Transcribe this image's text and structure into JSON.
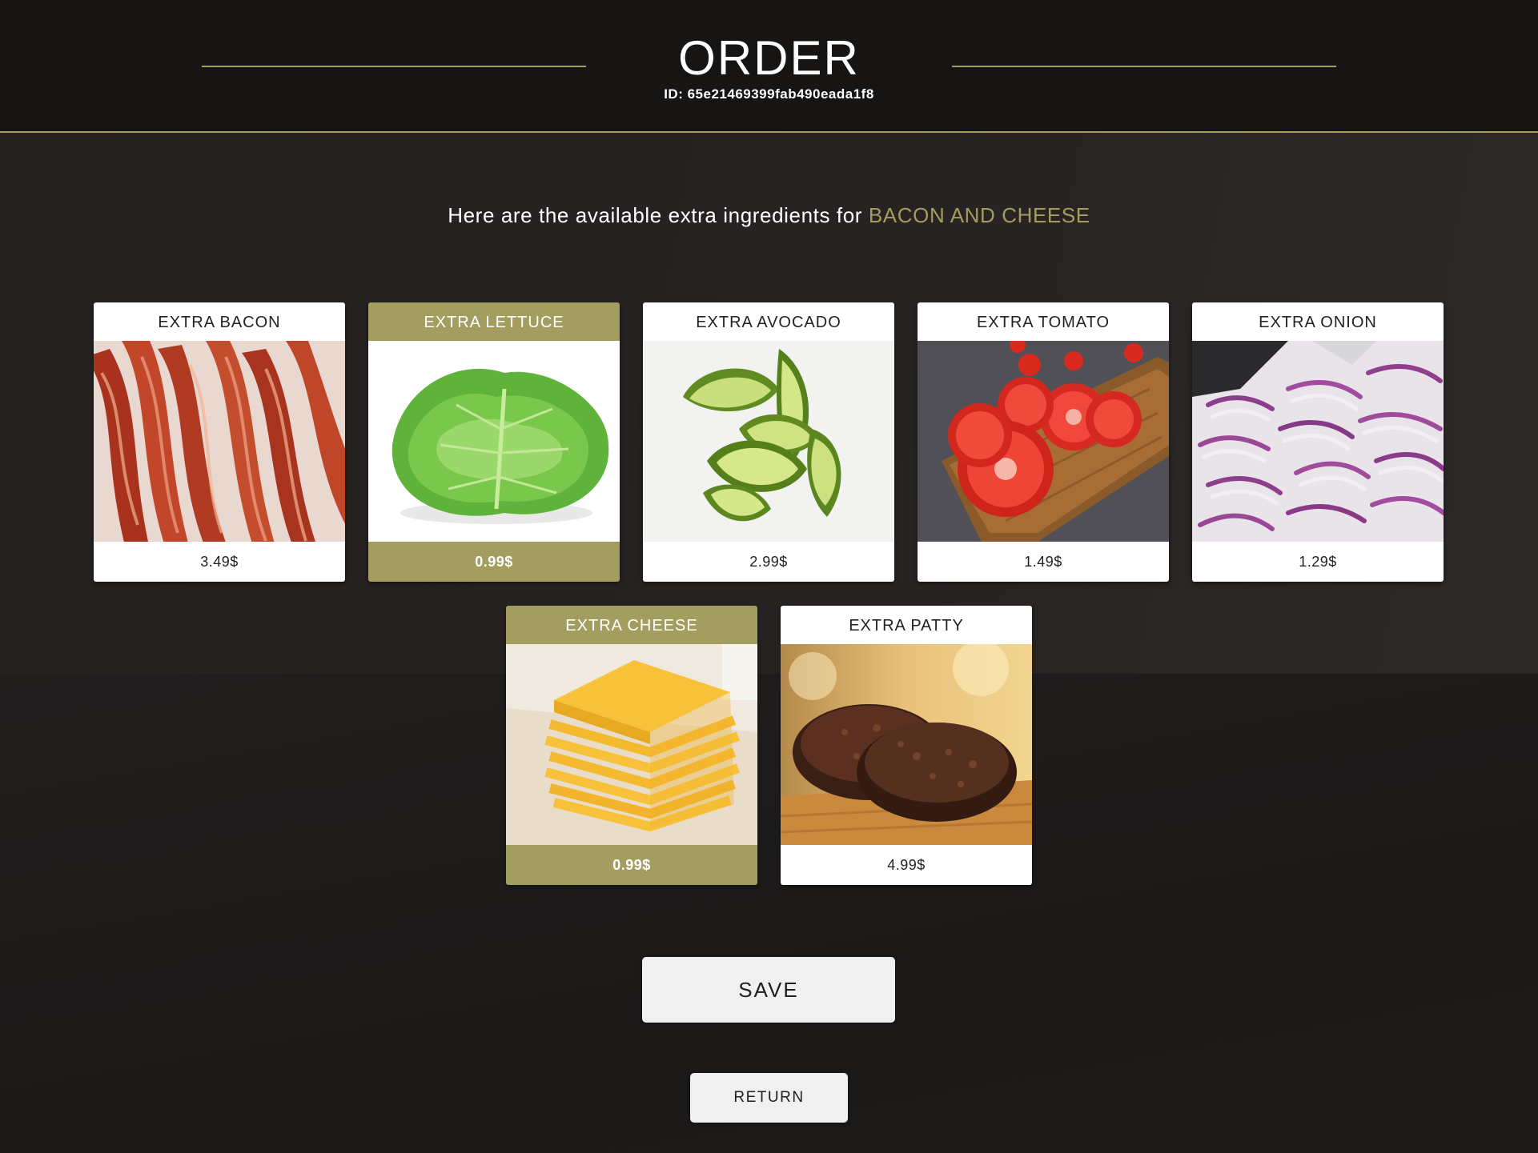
{
  "header": {
    "title": "ORDER",
    "order_id": "ID: 65e21469399fab490eada1f8"
  },
  "intro": {
    "text": "Here are the available extra ingredients for ",
    "product": "BACON AND CHEESE"
  },
  "colors": {
    "accent": "#a39d5f",
    "background": "#1c1a19",
    "card": "#ffffff",
    "button": "#f0f0f0"
  },
  "ingredients": [
    {
      "name": "EXTRA BACON",
      "price": "3.49$",
      "selected": false,
      "image": "bacon-image"
    },
    {
      "name": "EXTRA LETTUCE",
      "price": "0.99$",
      "selected": true,
      "image": "lettuce-image"
    },
    {
      "name": "EXTRA AVOCADO",
      "price": "2.99$",
      "selected": false,
      "image": "avocado-image"
    },
    {
      "name": "EXTRA TOMATO",
      "price": "1.49$",
      "selected": false,
      "image": "tomato-image"
    },
    {
      "name": "EXTRA ONION",
      "price": "1.29$",
      "selected": false,
      "image": "onion-image"
    },
    {
      "name": "EXTRA CHEESE",
      "price": "0.99$",
      "selected": true,
      "image": "cheese-image"
    },
    {
      "name": "EXTRA PATTY",
      "price": "4.99$",
      "selected": false,
      "image": "patty-image"
    }
  ],
  "actions": {
    "save_label": "SAVE",
    "return_label": "RETURN"
  }
}
